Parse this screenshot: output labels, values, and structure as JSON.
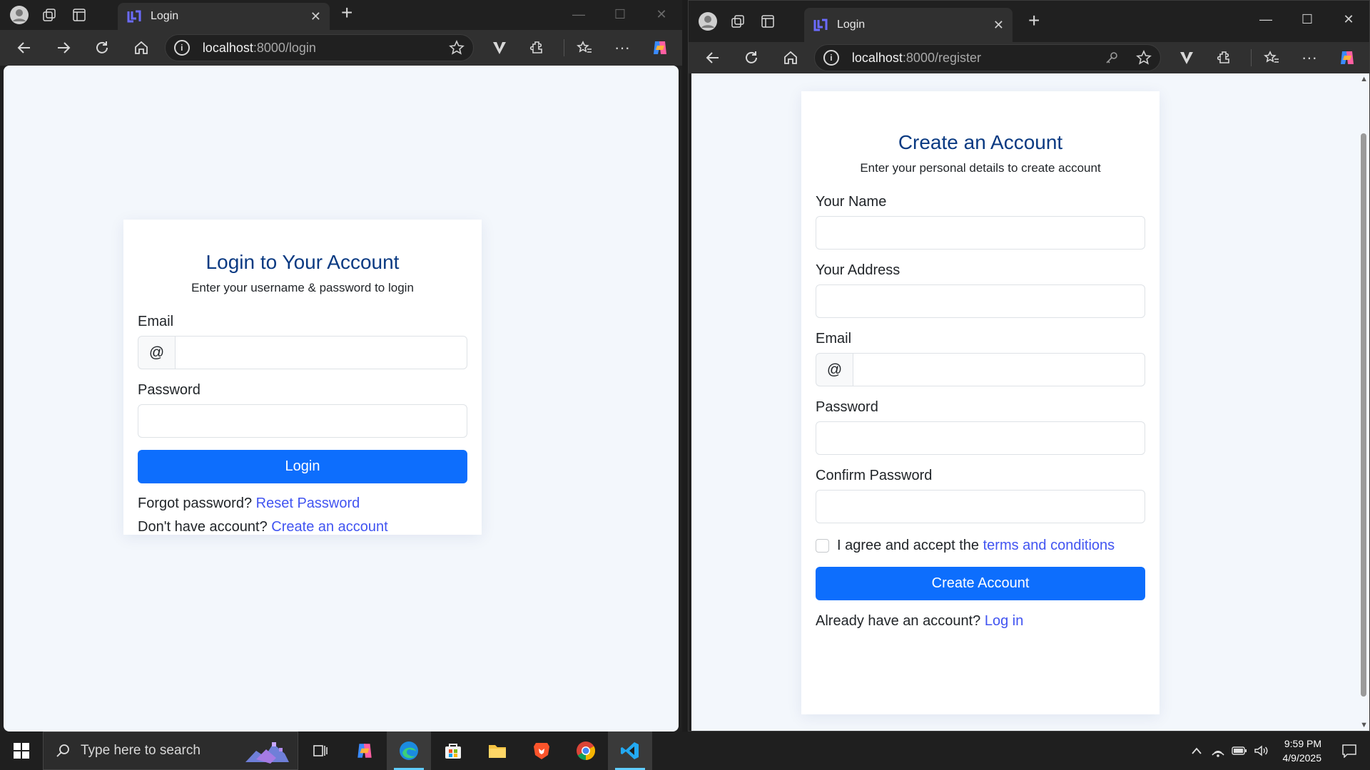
{
  "left_browser": {
    "tab_title": "Login",
    "url_host": "localhost",
    "url_rest": ":8000/login",
    "page": {
      "title": "Login to Your Account",
      "subtitle": "Enter your username & password to login",
      "email_label": "Email",
      "email_prefix": "@",
      "password_label": "Password",
      "login_button": "Login",
      "forgot_text": "Forgot password?",
      "reset_link": "Reset Password",
      "no_account_text": "Don't have account?",
      "create_link": "Create an account"
    }
  },
  "right_browser": {
    "tab_title": "Login",
    "url_host": "localhost",
    "url_rest": ":8000/register",
    "page": {
      "title": "Create an Account",
      "subtitle": "Enter your personal details to create account",
      "name_label": "Your Name",
      "address_label": "Your Address",
      "email_label": "Email",
      "email_prefix": "@",
      "password_label": "Password",
      "confirm_label": "Confirm Password",
      "agree_text": "I agree and accept the",
      "terms_link": "terms and conditions",
      "create_button": "Create Account",
      "have_account_text": "Already have an account?",
      "login_link": "Log in"
    }
  },
  "taskbar": {
    "search_placeholder": "Type here to search",
    "time": "9:59 PM",
    "date": "4/9/2025"
  },
  "colors": {
    "primary": "#0d6efd",
    "link": "#4154f1",
    "heading": "#0a3a82",
    "page_bg": "#f3f7fc"
  }
}
